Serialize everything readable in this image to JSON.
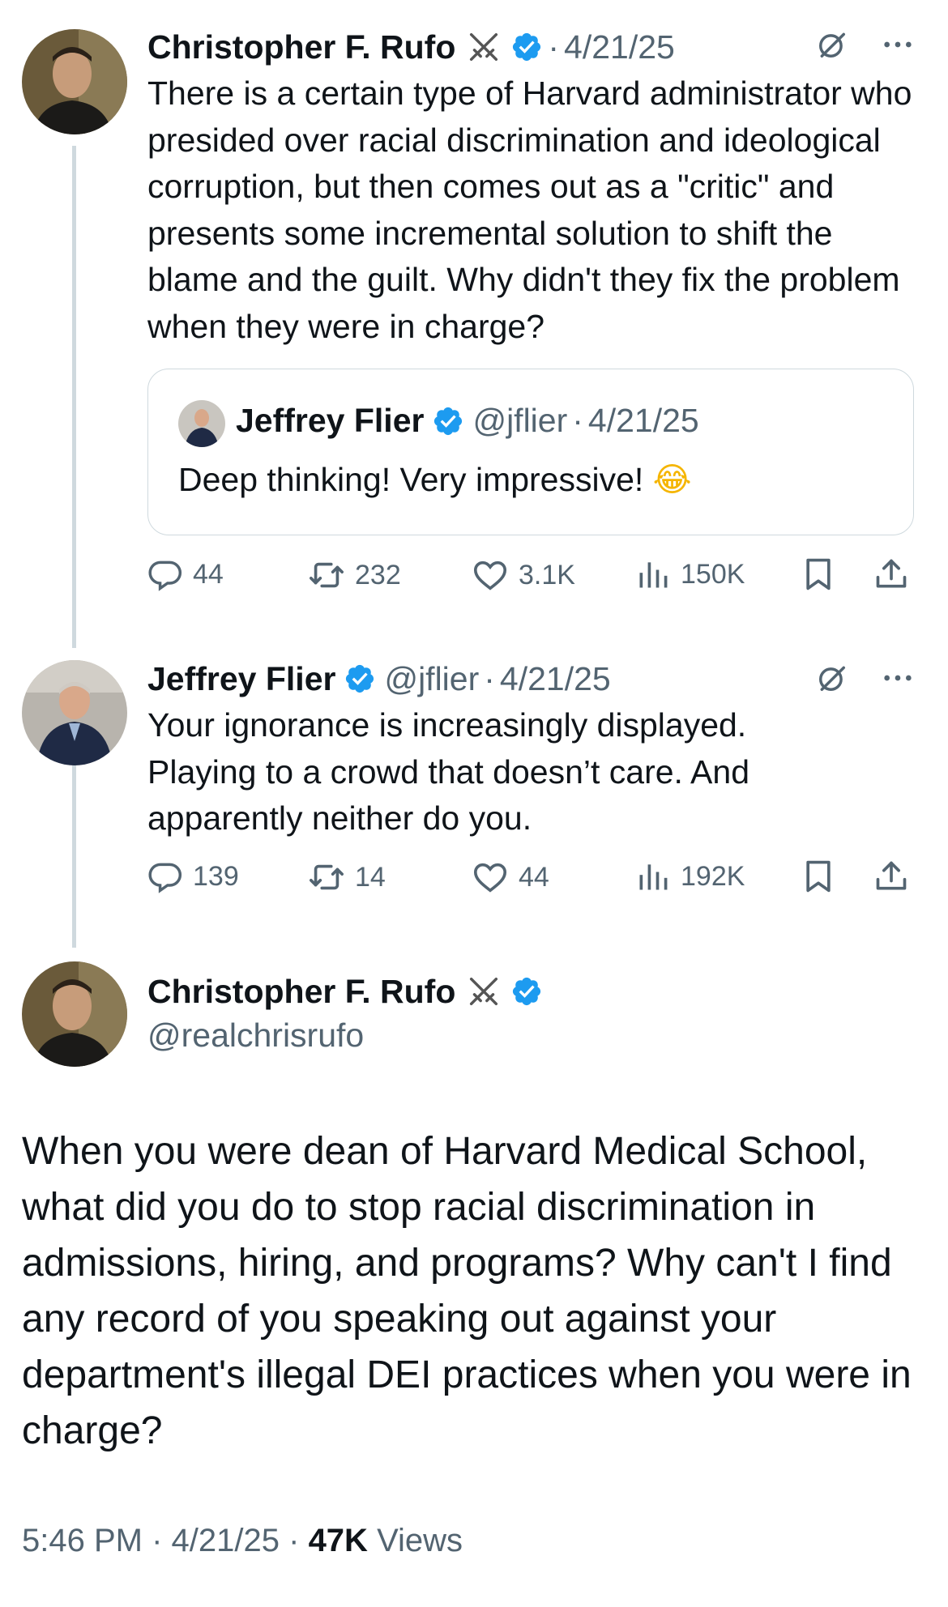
{
  "tweet1": {
    "author_name": "Christopher F. Rufo",
    "author_emoji": "⚔️",
    "date": "4/21/25",
    "text": "There is a certain type of Harvard administrator who presided over racial discrimination and ideological corruption, but then comes out as a \"critic\" and presents some incremental solution to shift the blame and the guilt. Why didn't they fix the problem when they were in charge?",
    "quote": {
      "author_name": "Jeffrey Flier",
      "handle": "@jflier",
      "date": "4/21/25",
      "text": "Deep thinking! Very impressive!",
      "emoji": "😂"
    },
    "actions": {
      "replies": "44",
      "reposts": "232",
      "likes": "3.1K",
      "views": "150K"
    }
  },
  "tweet2": {
    "author_name": "Jeffrey Flier",
    "handle": "@jflier",
    "date": "4/21/25",
    "text": "Your ignorance is increasingly displayed. Playing to a crowd that doesn’t care. And apparently neither do you.",
    "actions": {
      "replies": "139",
      "reposts": "14",
      "likes": "44",
      "views": "192K"
    }
  },
  "main_tweet": {
    "author_name": "Christopher F. Rufo",
    "author_emoji": "⚔️",
    "handle": "@realchrisrufo",
    "text": "When you were dean of Harvard Medical School, what did you do to stop racial discrimination in admissions, hiring, and programs? Why can't I find any record of you speaking out against your department's illegal DEI practices when you were in charge?",
    "time": "5:46 PM",
    "date": "4/21/25",
    "views_count": "47K",
    "views_label": "Views"
  },
  "colors": {
    "verified_blue": "#1d9bf0",
    "muted": "#536471",
    "text": "#0f1419",
    "border": "#cfd9de"
  },
  "icons": [
    "verified-badge-icon",
    "grok-icon",
    "more-icon",
    "reply-icon",
    "repost-icon",
    "like-icon",
    "views-icon",
    "bookmark-icon",
    "share-icon"
  ]
}
